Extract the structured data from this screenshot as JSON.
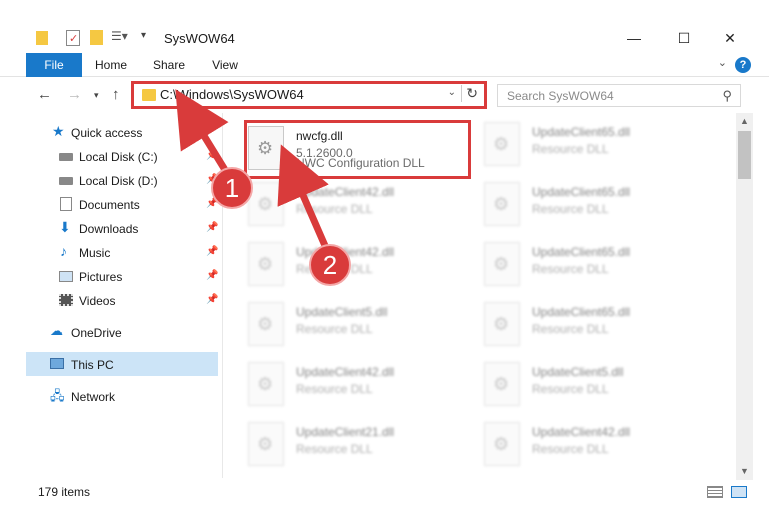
{
  "window": {
    "title": "SysWOW64",
    "minimize": "—",
    "maximize": "☐",
    "close": "✕"
  },
  "ribbon": {
    "tabs": [
      "File",
      "Home",
      "Share",
      "View"
    ],
    "help": "?"
  },
  "nav": {
    "address": "C:\\Windows\\SysWOW64",
    "search_placeholder": "Search SysWOW64"
  },
  "sidebar": {
    "items": [
      {
        "label": "Quick access"
      },
      {
        "label": "Local Disk (C:)"
      },
      {
        "label": "Local Disk (D:)"
      },
      {
        "label": "Documents"
      },
      {
        "label": "Downloads"
      },
      {
        "label": "Music"
      },
      {
        "label": "Pictures"
      },
      {
        "label": "Videos"
      },
      {
        "label": "OneDrive"
      },
      {
        "label": "This PC"
      },
      {
        "label": "Network"
      }
    ]
  },
  "files": {
    "highlighted": {
      "name": "nwcfg.dll",
      "version": "5.1.2600.0",
      "description": "NWC Configuration DLL"
    },
    "left_column": [
      {
        "name": "UpdateClient42.dll",
        "type": "Resource DLL"
      },
      {
        "name": "UpdateClient42.dll",
        "type": "Resource DLL"
      },
      {
        "name": "UpdateClient5.dll",
        "type": "Resource DLL"
      },
      {
        "name": "UpdateClient42.dll",
        "type": "Resource DLL"
      },
      {
        "name": "UpdateClient21.dll",
        "type": "Resource DLL"
      }
    ],
    "right_column": [
      {
        "name": "UpdateClient65.dll",
        "type": "Resource DLL"
      },
      {
        "name": "UpdateClient65.dll",
        "type": "Resource DLL"
      },
      {
        "name": "UpdateClient65.dll",
        "type": "Resource DLL"
      },
      {
        "name": "UpdateClient65.dll",
        "type": "Resource DLL"
      },
      {
        "name": "UpdateClient5.dll",
        "type": "Resource DLL"
      },
      {
        "name": "UpdateClient42.dll",
        "type": "Resource DLL"
      }
    ]
  },
  "status": {
    "item_count": "179 items"
  },
  "annotations": {
    "badge1": "1",
    "badge2": "2",
    "accent": "#d93b3b"
  }
}
